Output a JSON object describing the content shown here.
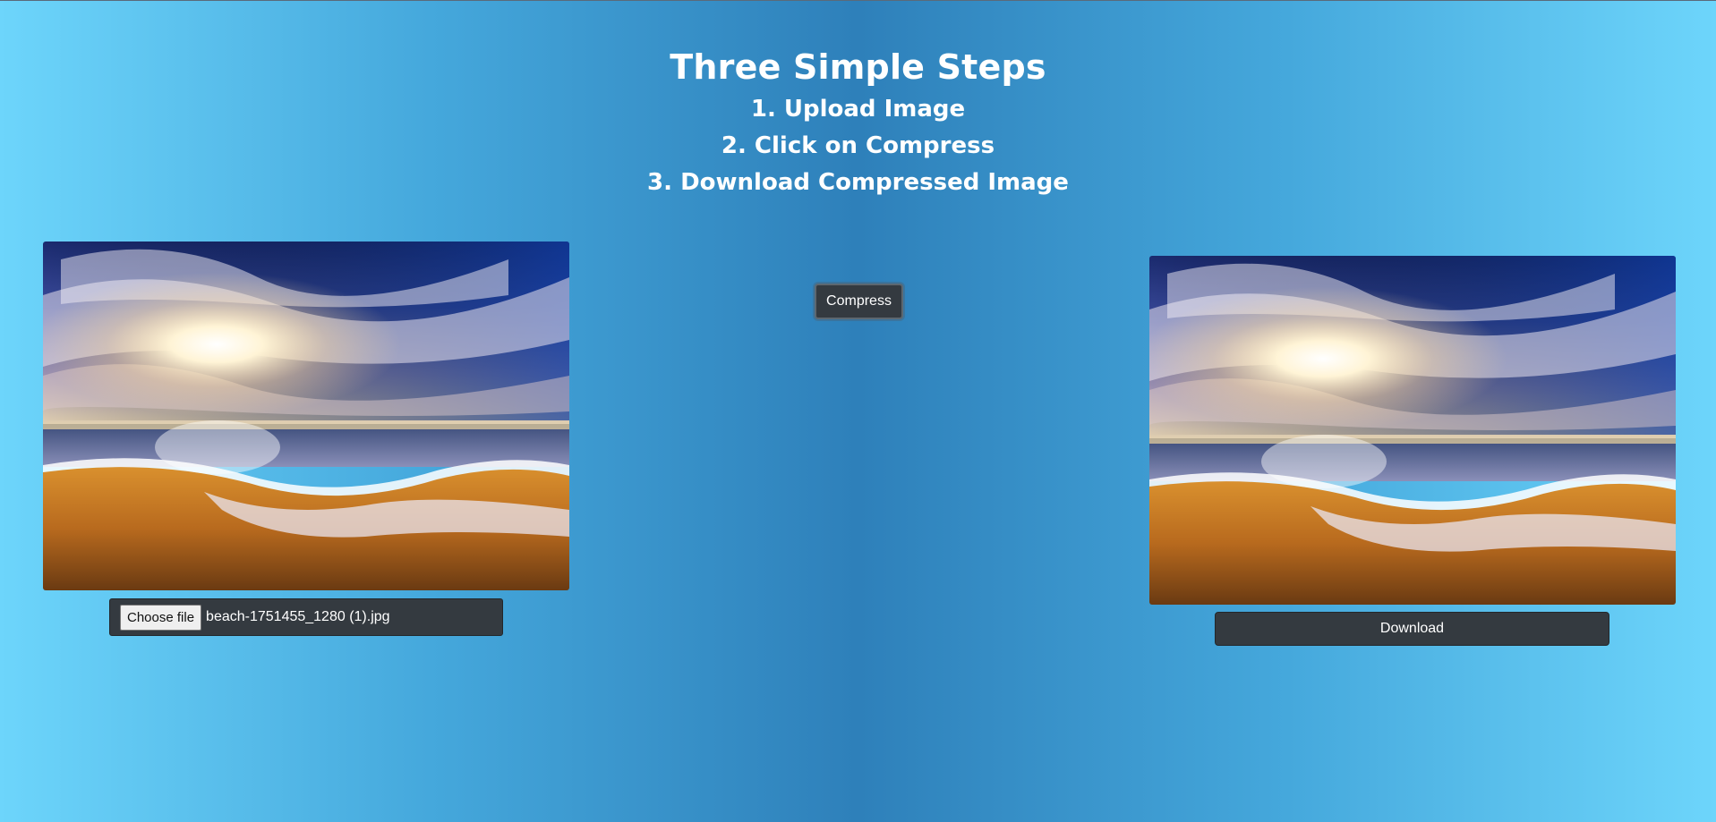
{
  "header": {
    "title": "Three Simple Steps",
    "steps": [
      "1. Upload Image",
      "2. Click on Compress",
      "3. Download Compressed Image"
    ]
  },
  "upload": {
    "choose_file_label": "Choose file",
    "file_name": "beach-1751455_1280 (1).jpg"
  },
  "actions": {
    "compress_label": "Compress",
    "download_label": "Download"
  },
  "colors": {
    "background_edge": "#6dd5fb",
    "background_center": "#2e80ba",
    "button_dark": "#343a40"
  }
}
